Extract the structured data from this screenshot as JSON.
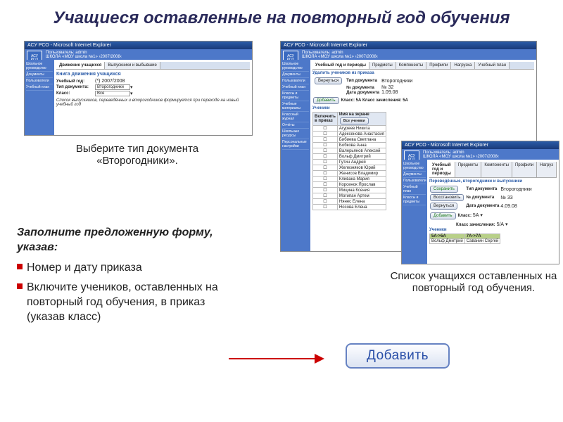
{
  "title": "Учащиеся оставленные на повторный год обучения",
  "caption1": "Выберите тип документа «Второгодники».",
  "caption2": "Список учащихся оставленных на повторный год обучения.",
  "instructions": {
    "heading": "Заполните предложенную форму, указав:",
    "b1": "Номер и дату приказа",
    "b2": "Включите учеников, оставленных на повторный год обучения, в приказ (указав класс)"
  },
  "bigButton": "Добавить",
  "window": {
    "title": "АСУ РСО - Microsoft Internet Explorer",
    "logo": "АСУ РСО",
    "user": "Пользователь: admin",
    "school": "ШКОЛА «МОУ школа №1»  ›2007/2008‹"
  },
  "sidebar": [
    "Школьное руководство",
    "Документы",
    "Пользователи",
    "Учебный план",
    "Классы и предметы",
    "Учебные материалы",
    "Классный журнал",
    "Отчёты",
    "Школьные ресурсы",
    "Персональные настройки"
  ],
  "shot1": {
    "tabs": [
      "Движение учащихся",
      "Выпускники и выбывшие"
    ],
    "heading": "Книга движения учащихся",
    "fields": {
      "year_lbl": "Учебный год:",
      "year_val": "(*) 2007/2008",
      "type_lbl": "Тип документа:",
      "type_val": "Второгодники",
      "class_lbl": "Класс:",
      "class_val": "Все"
    },
    "notice": "Список выпускников, переведённых и второгодников формируется при переходе на новый учебный год"
  },
  "shot2": {
    "tabs": [
      "Учебный год и периоды",
      "Предметы",
      "Компоненты",
      "Профили",
      "Нагрузка",
      "Учебный план"
    ],
    "sub": "Удалить учеников из приказа",
    "back": "Вернуться",
    "fields": {
      "type_lbl": "Тип документа",
      "type_val": "Второгодники",
      "num_lbl": "№ документа",
      "num_val": "№ 32",
      "date_lbl": "Дата документа",
      "date_val": "1.09.08"
    },
    "add": "Добавить",
    "class_info": "Класс: 5А   Класс зачисления: 5А",
    "section": "Ученики",
    "col1": "Включить в приказ",
    "col2": "Имя на экране",
    "allBtn": "Все ученики",
    "students": [
      "Агуреев Никита",
      "Адексенова Анастасия",
      "Бибиева Светлана",
      "Бобкова Анна",
      "Валерьянов Алексей",
      "Вольф Дмитрий",
      "Гутин Андрей",
      "Железняков Юрий",
      "Жениcов Владимир",
      "Кливака Мария",
      "Корсенок Ярослав",
      "Мицина Ксения",
      "Могипан Артем",
      "Нянес Елена",
      "Носова Елена"
    ]
  },
  "shot3": {
    "tabs": [
      "Учебный год и периоды",
      "Предметы",
      "Компоненты",
      "Профили",
      "Нагруз"
    ],
    "sub": "Переведённые, второгодники и выпускники",
    "save": "Сохранить",
    "restore": "Восстановить",
    "back": "Вернуться",
    "fields": {
      "type_lbl": "Тип документа",
      "type_val": "Второгодники",
      "num_lbl": "№ документа",
      "num_val": "№ 33",
      "date_lbl": "Дата документа",
      "date_val": "4.09.08"
    },
    "add": "Добавить",
    "class_lbl": "Класс:",
    "class_val": "5А",
    "class2_lbl": "Класс зачисления:",
    "class2_val": "5/А",
    "section": "Ученики",
    "hdr1": "5А->5А",
    "hdr2": "7А->7А",
    "s1": "Вольф Дмитрий",
    "s2": "Саванин Сергей"
  }
}
